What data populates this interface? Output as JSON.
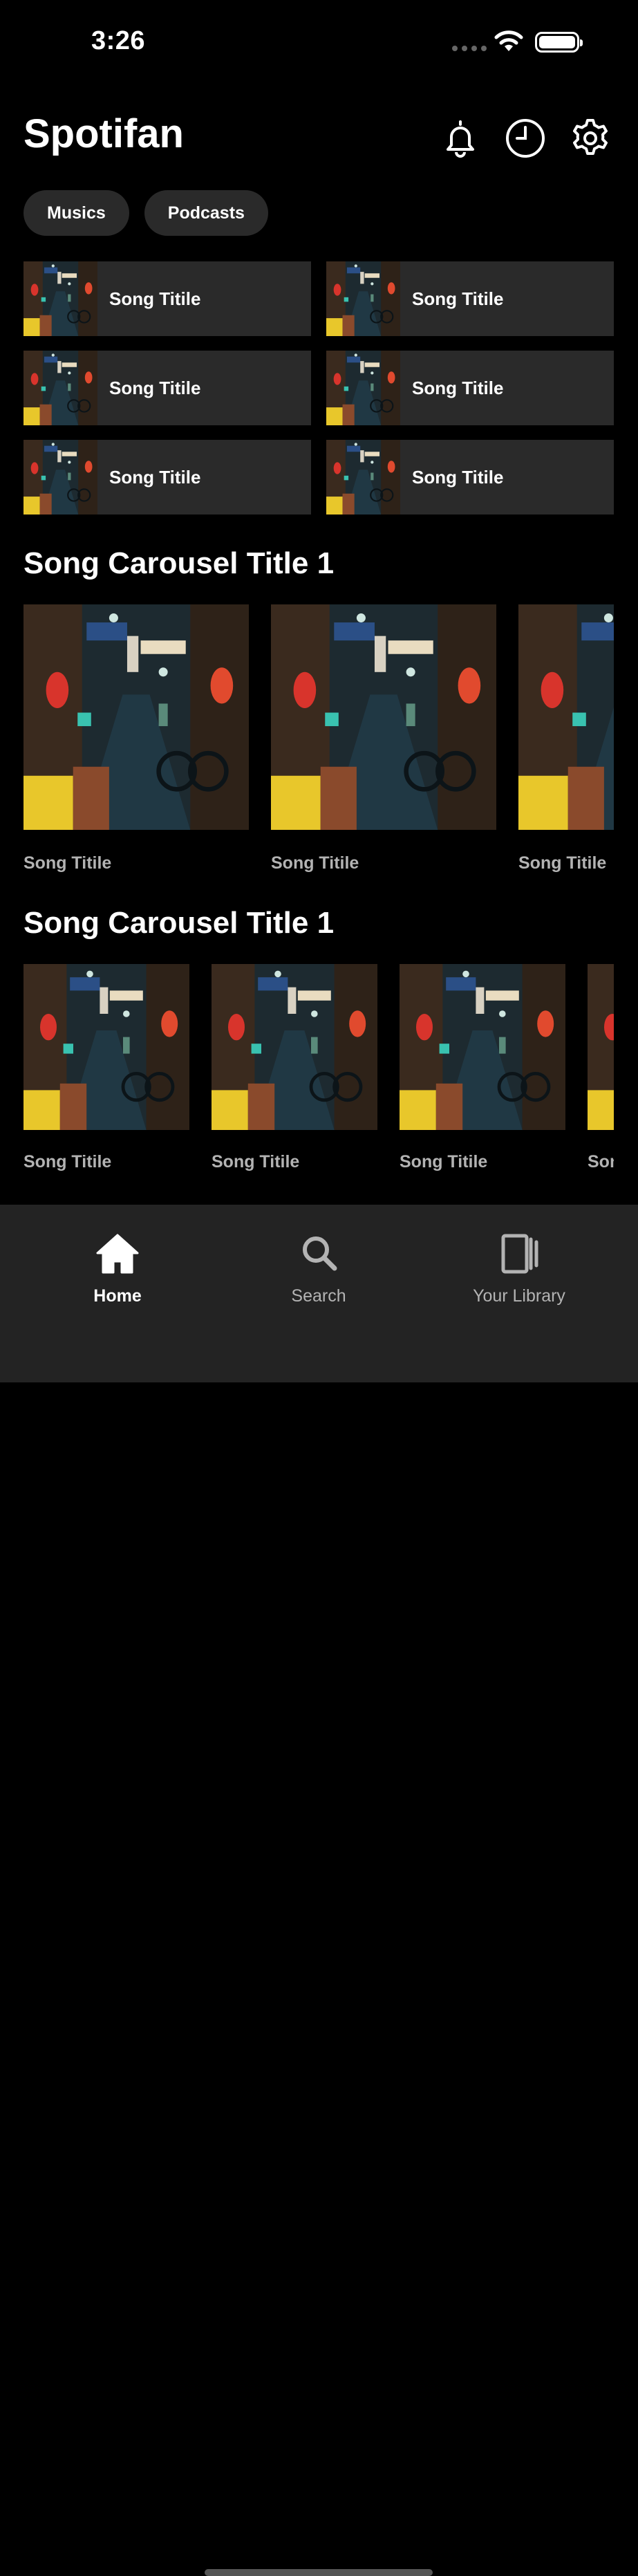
{
  "status_bar": {
    "time": "3:26"
  },
  "app": {
    "title": "Spotifan"
  },
  "header": {
    "icons": [
      "bell-icon",
      "history-icon",
      "gear-icon"
    ]
  },
  "filters": [
    "Musics",
    "Podcasts"
  ],
  "quick_picks": [
    {
      "title": "Song Titile"
    },
    {
      "title": "Song Titile"
    },
    {
      "title": "Song Titile"
    },
    {
      "title": "Song Titile"
    },
    {
      "title": "Song Titile"
    },
    {
      "title": "Song Titile"
    }
  ],
  "carousels": [
    {
      "title": "Song Carousel Title 1",
      "items": [
        {
          "title": "Song Titile"
        },
        {
          "title": "Song Titile"
        },
        {
          "title": "Song Titile"
        }
      ]
    },
    {
      "title": "Song Carousel Title 1",
      "items": [
        {
          "title": "Song Titile"
        },
        {
          "title": "Song Titile"
        },
        {
          "title": "Song Titile"
        },
        {
          "title": "Song Titile"
        }
      ]
    }
  ],
  "tab_bar": [
    {
      "label": "Home",
      "icon": "home-icon",
      "active": true
    },
    {
      "label": "Search",
      "icon": "search-icon",
      "active": false
    },
    {
      "label": "Your Library",
      "icon": "library-icon",
      "active": false
    }
  ],
  "colors": {
    "background": "#000000",
    "surface": "#2a2a2a",
    "tab_bar": "#232323",
    "muted_text": "#b3b3b3"
  }
}
